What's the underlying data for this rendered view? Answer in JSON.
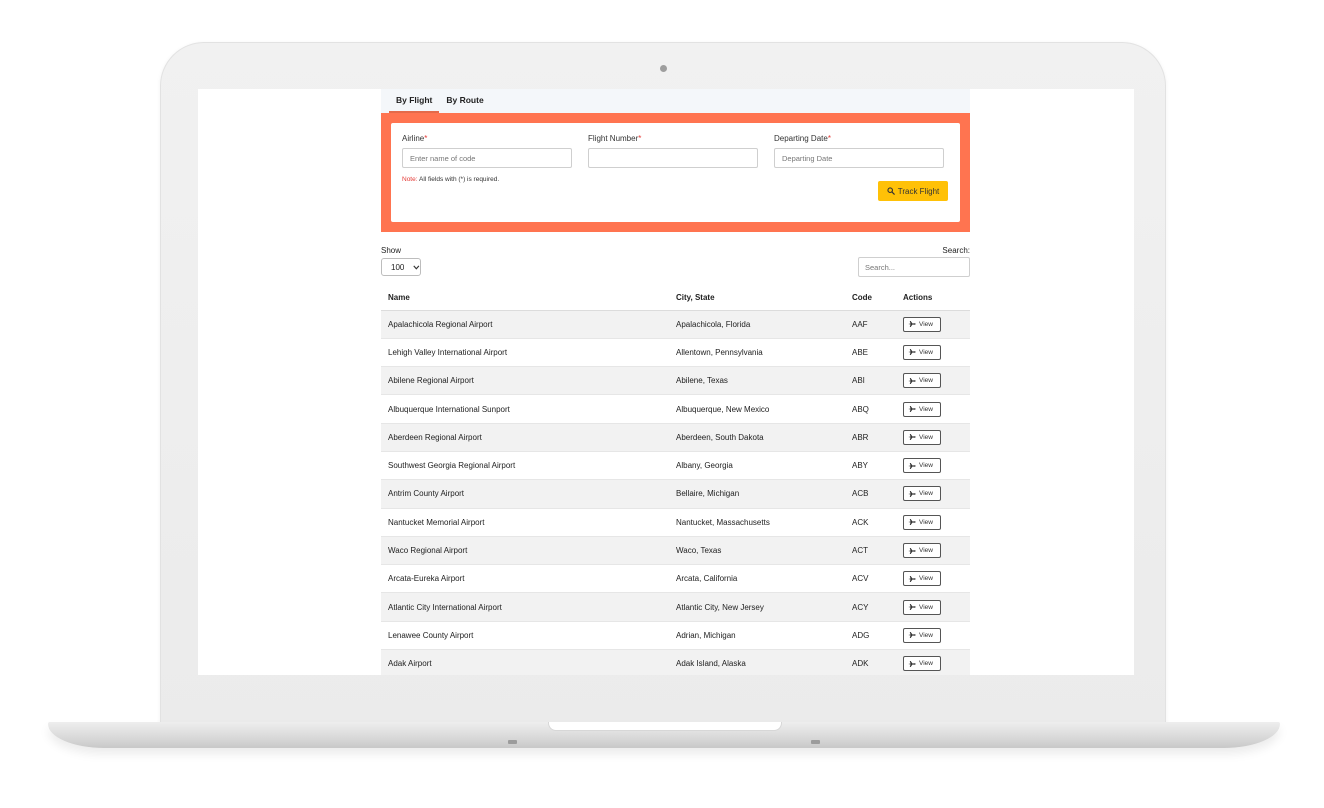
{
  "tabs": [
    {
      "label": "By Flight",
      "active": true
    },
    {
      "label": "By Route",
      "active": false
    }
  ],
  "form": {
    "airline_label": "Airline",
    "airline_placeholder": "Enter name of code",
    "flight_number_label": "Flight Number",
    "flight_number_placeholder": "",
    "date_label": "Departing Date",
    "date_placeholder": "Departing Date",
    "required_mark": "*",
    "note_label": "Note:",
    "note_text": " All fields with (*) is required.",
    "track_button": "Track Flight"
  },
  "controls": {
    "show_label": "Show",
    "show_value": "100",
    "search_label": "Search:",
    "search_placeholder": "Search..."
  },
  "table": {
    "headers": [
      "Name",
      "City, State",
      "Code",
      "Actions"
    ],
    "view_label": "View",
    "rows": [
      {
        "name": "Apalachicola Regional Airport",
        "city": "Apalachicola, Florida",
        "code": "AAF"
      },
      {
        "name": "Lehigh Valley International Airport",
        "city": "Allentown, Pennsylvania",
        "code": "ABE"
      },
      {
        "name": "Abilene Regional Airport",
        "city": "Abilene, Texas",
        "code": "ABI"
      },
      {
        "name": "Albuquerque International Sunport",
        "city": "Albuquerque, New Mexico",
        "code": "ABQ"
      },
      {
        "name": "Aberdeen Regional Airport",
        "city": "Aberdeen, South Dakota",
        "code": "ABR"
      },
      {
        "name": "Southwest Georgia Regional Airport",
        "city": "Albany, Georgia",
        "code": "ABY"
      },
      {
        "name": "Antrim County Airport",
        "city": "Bellaire, Michigan",
        "code": "ACB"
      },
      {
        "name": "Nantucket Memorial Airport",
        "city": "Nantucket, Massachusetts",
        "code": "ACK"
      },
      {
        "name": "Waco Regional Airport",
        "city": "Waco, Texas",
        "code": "ACT"
      },
      {
        "name": "Arcata-Eureka Airport",
        "city": "Arcata, California",
        "code": "ACV"
      },
      {
        "name": "Atlantic City International Airport",
        "city": "Atlantic City, New Jersey",
        "code": "ACY"
      },
      {
        "name": "Lenawee County Airport",
        "city": "Adrian, Michigan",
        "code": "ADG"
      },
      {
        "name": "Adak Airport",
        "city": "Adak Island, Alaska",
        "code": "ADK"
      }
    ]
  },
  "colors": {
    "panel_accent": "#ff7450",
    "track_button": "#ffc107",
    "required": "#e53935"
  }
}
